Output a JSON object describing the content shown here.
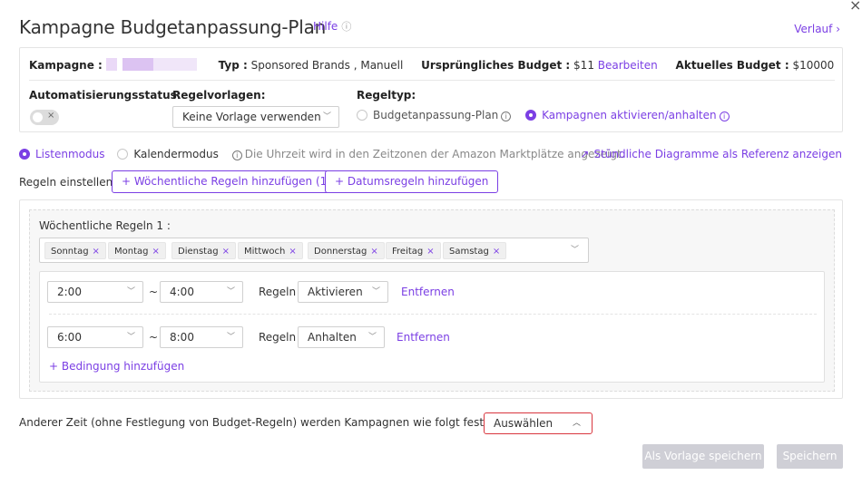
{
  "header": {
    "title": "Kampagne Budgetanpassung-Plan",
    "help_label": "Hilfe",
    "history_label": "Verlauf ›"
  },
  "campaign_info": {
    "campaign_label": "Kampagne :",
    "type_label": "Typ :",
    "type_value": "Sponsored Brands , Manuell",
    "original_budget_label": "Ursprüngliches Budget :",
    "original_budget_value": "$11",
    "edit_label": "Bearbeiten",
    "current_budget_label": "Aktuelles Budget :",
    "current_budget_value": "$10000"
  },
  "settings": {
    "automation_label": "Automatisierungsstatus:",
    "toggle_symbol": "×",
    "templates_label": "Regelvorlagen:",
    "template_selected": "Keine Vorlage verwenden",
    "rule_type_label": "Regeltyp:",
    "rule_type_options": [
      "Budgetanpassung-Plan",
      "Kampagnen aktivieren/anhalten"
    ],
    "rule_type_selected": "Kampagnen aktivieren/anhalten"
  },
  "mode": {
    "list_mode": "Listenmodus",
    "calendar_mode": "Kalendermodus",
    "selected": "Listenmodus",
    "timezone_note": "Die Uhrzeit wird in den Zeitzonen der Amazon Marktplätze angezeigt.",
    "chart_link": "Stündliche Diagramme als Referenz anzeigen"
  },
  "rules": {
    "set_rules_label": "Regeln einstellen:",
    "add_weekly_button": "+ Wöchentliche Regeln hinzufügen (1)",
    "add_date_button": "+ Datumsregeln hinzufügen",
    "weekly_title": "Wöchentliche Regeln 1 :",
    "days": [
      "Sonntag",
      "Montag",
      "Dienstag",
      "Mittwoch",
      "Donnerstag",
      "Freitag",
      "Samstag"
    ],
    "tag_remove_symbol": "×",
    "tilde": "~",
    "rules_word": "Regeln",
    "remove_label": "Entfernen",
    "conditions": [
      {
        "from": "2:00",
        "to": "4:00",
        "action": "Aktivieren"
      },
      {
        "from": "6:00",
        "to": "8:00",
        "action": "Anhalten"
      }
    ],
    "add_condition": "+ Bedingung hinzufügen"
  },
  "footer": {
    "other_time_text": "Anderer Zeit (ohne Festlegung von Budget-Regeln) werden Kampagnen wie folgt festgelegt:",
    "select_placeholder": "Auswählen",
    "save_template_button": "Als Vorlage speichern",
    "save_button": "Speichern"
  },
  "colors": {
    "accent": "#7b3fe4",
    "error_border": "#d9363e",
    "disabled_button": "#cfcfd6"
  }
}
